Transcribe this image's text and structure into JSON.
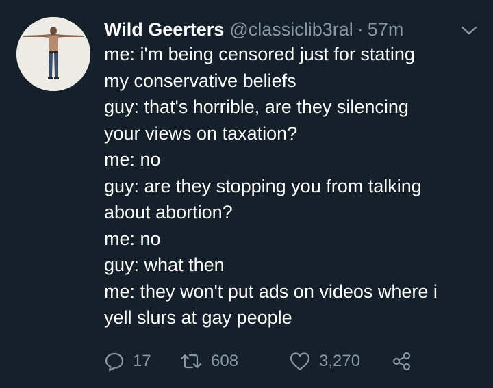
{
  "tweet": {
    "author": {
      "display_name": "Wild Geerters",
      "handle": "@classiclib3ral",
      "separator": "·",
      "timestamp": "57m"
    },
    "lines": [
      "me: i'm being censored just for stating",
      "my conservative beliefs",
      "guy: that's horrible, are they silencing",
      "your views on taxation?",
      "me: no",
      "guy: are they stopping you from talking",
      "about abortion?",
      "me: no",
      "guy: what then",
      "me: they won't put ads on videos where i",
      "yell slurs at gay people"
    ],
    "actions": {
      "reply_count": "17",
      "retweet_count": "608",
      "like_count": "3,270"
    },
    "icons": {
      "avatar": "avatar-image",
      "caret": "chevron-down-icon",
      "reply": "reply-icon",
      "retweet": "retweet-icon",
      "like": "heart-icon",
      "share": "share-icon"
    },
    "colors": {
      "background": "#15202b",
      "text": "#ffffff",
      "secondary": "#8899a6"
    }
  }
}
